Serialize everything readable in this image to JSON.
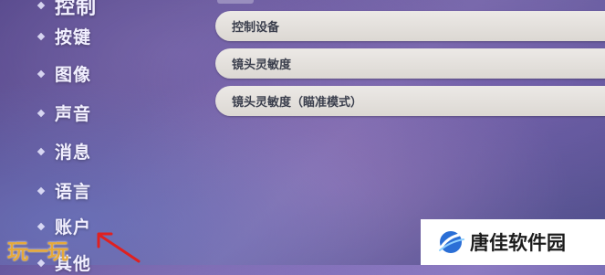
{
  "sidebar": {
    "items": [
      {
        "label": "控制"
      },
      {
        "label": "按键"
      },
      {
        "label": "图像"
      },
      {
        "label": "声音"
      },
      {
        "label": "消息"
      },
      {
        "label": "语言"
      },
      {
        "label": "账户"
      },
      {
        "label": "其他"
      }
    ]
  },
  "settings": {
    "rows": [
      {
        "label": "控制设备"
      },
      {
        "label": "镜头灵敏度"
      },
      {
        "label": "镜头灵敏度（瞄准模式）"
      }
    ]
  },
  "watermarks": {
    "left": "玩一玩",
    "right": "唐佳软件园"
  },
  "colors": {
    "arrow": "#e02020",
    "watermark_left": "#e6a93a",
    "row_bg": "#e6e3df"
  }
}
